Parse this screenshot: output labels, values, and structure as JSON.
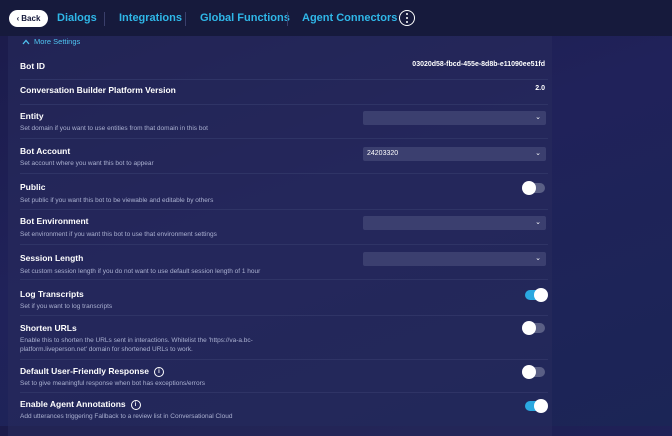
{
  "nav": {
    "back_label": "Back",
    "tabs": [
      "Dialogs",
      "Integrations",
      "Global Functions",
      "Agent Connectors"
    ]
  },
  "section": {
    "toggle_label": "More Settings"
  },
  "settings": {
    "bot_id": {
      "label": "Bot ID",
      "value": "03020d58-fbcd-455e-8d8b-e11090ee51fd"
    },
    "platform_version": {
      "label": "Conversation Builder Platform Version",
      "value": "2.0"
    },
    "entity": {
      "label": "Entity",
      "desc": "Set domain if you want to use entities from that domain in this bot",
      "value": ""
    },
    "bot_account": {
      "label": "Bot Account",
      "desc": "Set account where you want this bot to appear",
      "value": "24203320"
    },
    "public": {
      "label": "Public",
      "desc": "Set public if you want this bot to be viewable and editable by others",
      "on": false
    },
    "bot_environment": {
      "label": "Bot Environment",
      "desc": "Set environment if you want this bot to use that environment settings",
      "value": ""
    },
    "session_length": {
      "label": "Session Length",
      "desc": "Set custom session length if you do not want to use default session length of 1 hour",
      "value": ""
    },
    "log_transcripts": {
      "label": "Log Transcripts",
      "desc": "Set if you want to log transcripts",
      "on": true
    },
    "shorten_urls": {
      "label": "Shorten URLs",
      "desc_line1": "Enable this to shorten the URLs sent in interactions. Whitelist the 'https://va-a.bc-",
      "desc_line2": "platform.liveperson.net' domain for shortened URLs to work.",
      "on": false
    },
    "friendly_response": {
      "label": "Default User-Friendly Response",
      "desc": "Set to give meaningful response when bot has exceptions/errors",
      "on": false
    },
    "agent_annotations": {
      "label": "Enable Agent Annotations",
      "desc": "Add utterances triggering Fallback to a review list in Conversational Cloud",
      "on": true
    }
  },
  "colors": {
    "accent": "#2fb7e8",
    "toggle_on": "#2aa8e0",
    "toggle_off": "#5a5f85"
  }
}
